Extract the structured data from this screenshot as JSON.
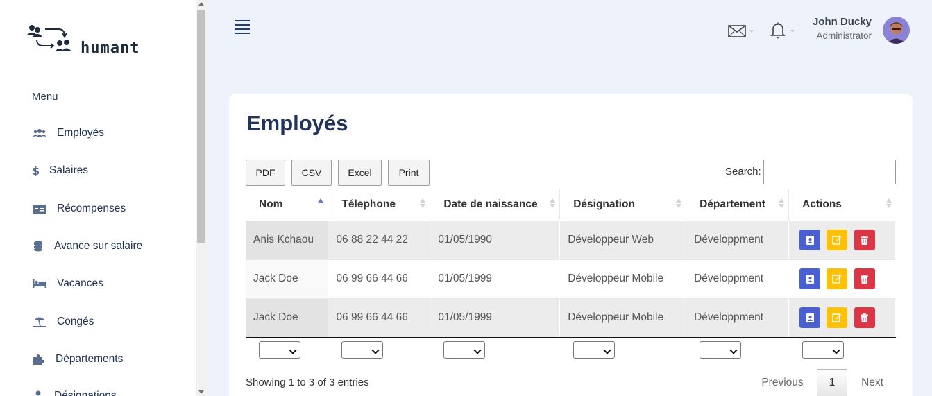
{
  "brand": {
    "name": "humant"
  },
  "sidebar": {
    "heading": "Menu",
    "items": [
      {
        "label": "Employés",
        "icon": "users-icon"
      },
      {
        "label": "Salaires",
        "icon": "dollar-icon"
      },
      {
        "label": "Récompenses",
        "icon": "money-card-icon"
      },
      {
        "label": "Avance sur salaire",
        "icon": "coins-icon"
      },
      {
        "label": "Vacances",
        "icon": "bed-icon"
      },
      {
        "label": "Congés",
        "icon": "umbrella-beach-icon"
      },
      {
        "label": "Départements",
        "icon": "puzzle-icon"
      },
      {
        "label": "Désignations",
        "icon": "user-icon"
      }
    ]
  },
  "header": {
    "user": {
      "name": "John Ducky",
      "role": "Administrator"
    }
  },
  "page": {
    "title": "Employés",
    "export_buttons": [
      "PDF",
      "CSV",
      "Excel",
      "Print"
    ],
    "search": {
      "label": "Search:",
      "value": ""
    },
    "table": {
      "columns": [
        "Nom",
        "Télephone",
        "Date de naissance",
        "Désignation",
        "Département",
        "Actions"
      ],
      "sorted_column": "Nom",
      "rows": [
        [
          "Anis Kchaou",
          "06 88 22 44 22",
          "01/05/1990",
          "Développeur Web",
          "Développment"
        ],
        [
          "Jack Doe",
          "06 99 66 44 66",
          "01/05/1999",
          "Développeur Mobile",
          "Développment"
        ],
        [
          "Jack Doe",
          "06 99 66 44 66",
          "01/05/1999",
          "Développeur Mobile",
          "Développment"
        ]
      ],
      "action_icons": [
        "contact-card-icon",
        "edit-icon",
        "trash-icon"
      ]
    },
    "info": "Showing 1 to 3 of 3 entries",
    "pagination": {
      "previous": "Previous",
      "current": "1",
      "next": "Next"
    }
  },
  "colors": {
    "accent": "#23345c",
    "view_button": "#4a5fd0",
    "edit_button": "#ffc107",
    "delete_button": "#dc3545",
    "background": "#eef2fb"
  }
}
